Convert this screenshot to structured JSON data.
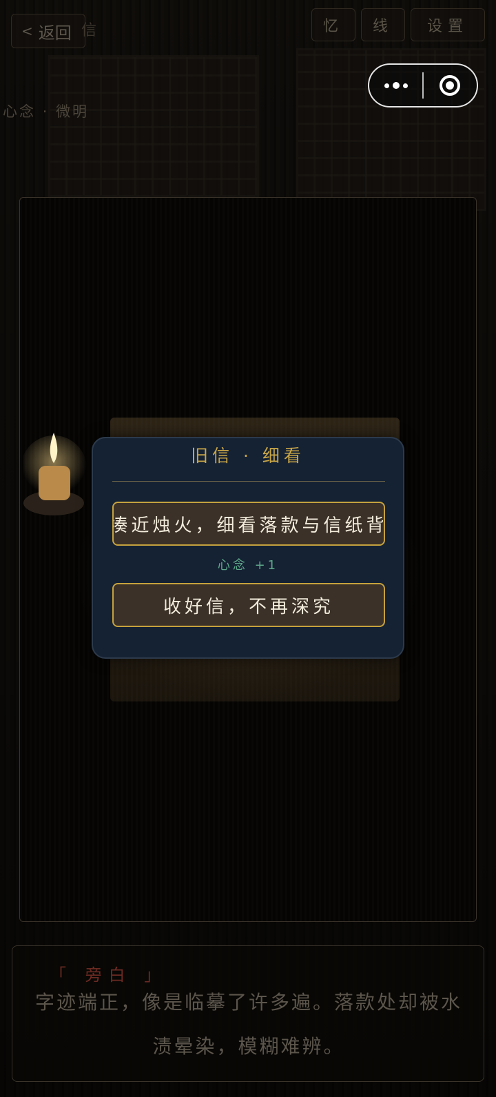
{
  "topbar": {
    "back_chevron": "<",
    "back_label": "返回",
    "faded_title": "信",
    "tabs": [
      "忆",
      "线",
      "设置"
    ]
  },
  "status": {
    "mind_label": "心念",
    "separator": "·",
    "mind_value": "微明"
  },
  "dialog": {
    "title": "旧信 · 细看",
    "choices": [
      {
        "label": "凑近烛火，细看落款与信纸背",
        "effect": "心念 +1"
      },
      {
        "label": "收好信，不再深究"
      }
    ]
  },
  "narration": {
    "speaker": "「 旁白 」",
    "text": "字迹端正，像是临摹了许多遍。落款处却被水渍晕染，模糊难辨。"
  },
  "colors": {
    "accent_gold": "#c9a648",
    "dialog_bg": "#152234",
    "choice_bg": "#3b3128",
    "effect_green": "#5ea88a",
    "speaker_red": "#6a2a22"
  }
}
